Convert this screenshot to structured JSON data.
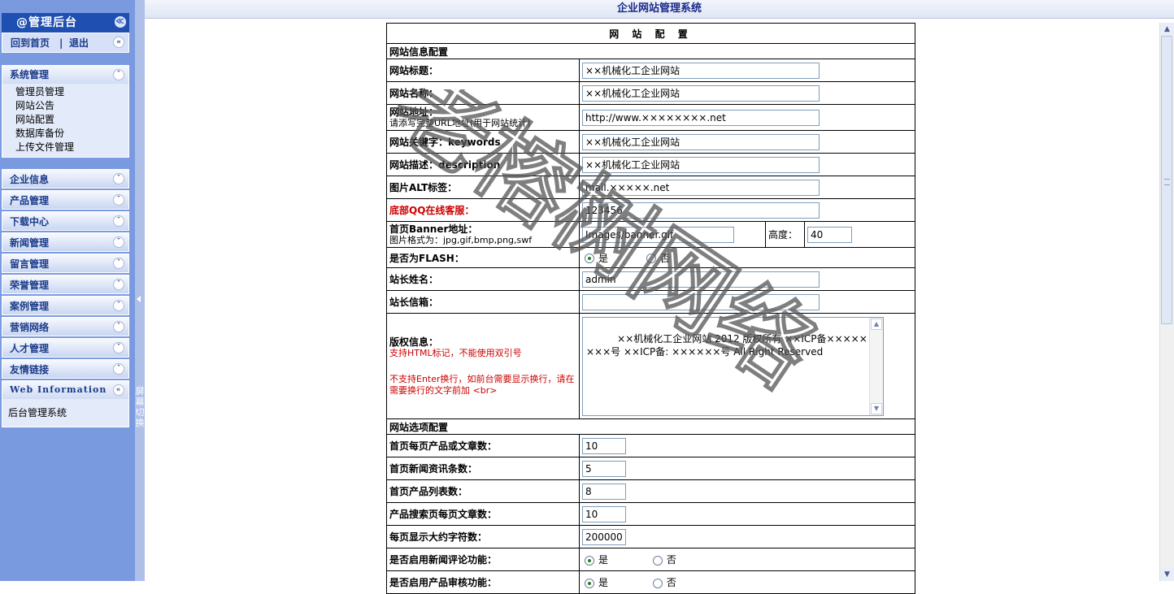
{
  "app_title": "企业网站管理系统",
  "sidebar": {
    "header": "@管理后台",
    "links": {
      "home": "回到首页",
      "sep": "|",
      "logout": "退出"
    },
    "system": {
      "title": "系统管理",
      "items": [
        "管理员管理",
        "网站公告",
        "网站配置",
        "数据库备份",
        "上传文件管理"
      ]
    },
    "menus": [
      "企业信息",
      "产品管理",
      "下载中心",
      "新闻管理",
      "留言管理",
      "荣誉管理",
      "案例管理",
      "营销网络",
      "人才管理",
      "友情链接"
    ],
    "web_info": {
      "title": "Web Information",
      "text": "后台管理系统"
    },
    "toggle_text": "屏幕切换"
  },
  "form": {
    "title": "网 站 配 置",
    "section_info": "网站信息配置",
    "site_title": {
      "label": "网站标题：",
      "value": "××机械化工企业网站"
    },
    "site_name": {
      "label": "网站名称：",
      "value": "××机械化工企业网站"
    },
    "site_url": {
      "label": "网站地址：",
      "hint": "请添写完整URL地址(用于网站统计)",
      "value": "http://www.××××××××.net"
    },
    "keywords": {
      "label": "网站关键字：keywords",
      "value": "××机械化工企业网站"
    },
    "description": {
      "label": "网站描述：description",
      "value": "××机械化工企业网站"
    },
    "img_alt": {
      "label": "图片ALT标签：",
      "value": "mail.×××××.net"
    },
    "qq": {
      "label": "底部QQ在线客服：",
      "value": "123456"
    },
    "banner": {
      "label": "首页Banner地址：",
      "hint": "图片格式为：jpg,gif,bmp,png,swf",
      "value": "Images/banner.gif",
      "height_label": "高度：",
      "height_value": "40"
    },
    "is_flash": {
      "label": "是否为FLASH：",
      "yes": "是",
      "no": "否"
    },
    "admin_name": {
      "label": "站长姓名：",
      "value": "admin"
    },
    "admin_email": {
      "label": "站长信箱：",
      "value": ""
    },
    "copyright": {
      "label": "版权信息：",
      "hint1": "支持HTML标记，不能使用双引号",
      "hint2": "不支持Enter换行，如前台需要显示换行，请在需要换行的文字前加 <br>",
      "value": "××机械化工企业网站 2012 版权所有 ××ICP备××××××××号 ××ICP备: ××××××号 All Right Reserved"
    },
    "section_options": "网站选项配置",
    "home_products": {
      "label": "首页每页产品或文章数：",
      "value": "10"
    },
    "home_news": {
      "label": "首页新闻资讯条数：",
      "value": "5"
    },
    "home_product_list": {
      "label": "首页产品列表数：",
      "value": "8"
    },
    "search_per_page": {
      "label": "产品搜索页每页文章数：",
      "value": "10"
    },
    "max_chars": {
      "label": "每页显示大约字符数：",
      "value": "200000"
    },
    "news_comment": {
      "label": "是否启用新闻评论功能：",
      "yes": "是",
      "no": "否"
    },
    "product_audit": {
      "label": "是否启用产品审核功能：",
      "yes": "是",
      "no": "否"
    }
  },
  "watermark": "老榕树网络"
}
